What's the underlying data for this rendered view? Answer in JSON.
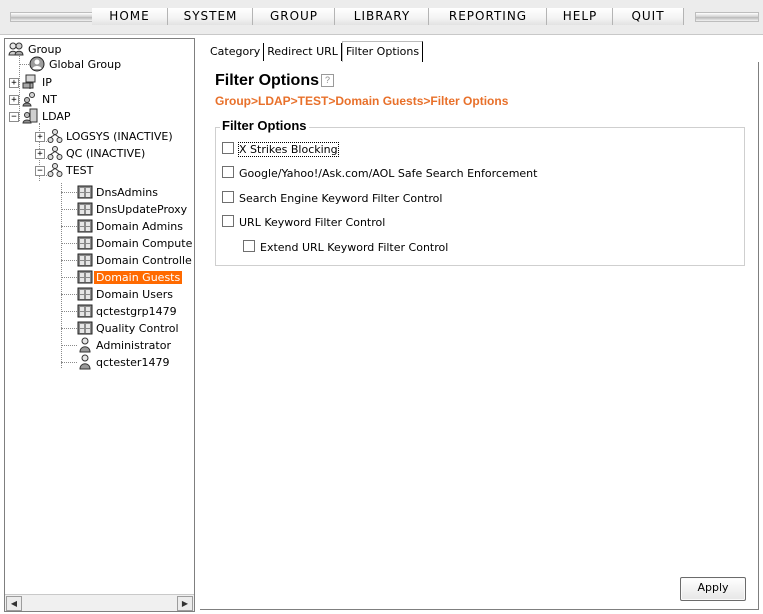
{
  "menu": [
    "HOME",
    "SYSTEM",
    "GROUP",
    "LIBRARY",
    "REPORTING",
    "HELP",
    "QUIT"
  ],
  "tree": {
    "root": "Group",
    "global_group": "Global Group",
    "ip": "IP",
    "nt": "NT",
    "ldap": "LDAP",
    "logsys": "LOGSYS (INACTIVE)",
    "qc": "QC (INACTIVE)",
    "test": "TEST",
    "groups": [
      "DnsAdmins",
      "DnsUpdateProxy",
      "Domain Admins",
      "Domain Compute",
      "Domain Controlle",
      "Domain Guests",
      "Domain Users",
      "qctestgrp1479",
      "Quality Control"
    ],
    "users": [
      "Administrator",
      "qctester1479"
    ],
    "selected": "Domain Guests"
  },
  "tabs": [
    "Category",
    "Redirect URL",
    "Filter Options"
  ],
  "active_tab": "Filter Options",
  "page": {
    "title": "Filter Options",
    "help": "?",
    "breadcrumb": "Group>LDAP>TEST>Domain Guests>Filter Options",
    "section_title": "Filter Options"
  },
  "options": {
    "x_strikes": "X Strikes Blocking",
    "safe_search": "Google/Yahoo!/Ask.com/AOL Safe Search Enforcement",
    "search_engine_keyword": "Search Engine Keyword Filter Control",
    "url_keyword": "URL Keyword Filter Control",
    "extend_url_keyword": "Extend URL Keyword Filter Control"
  },
  "apply_label": "Apply",
  "colors": {
    "breadcrumb": "#e8702a",
    "selection": "#ff6a00"
  }
}
